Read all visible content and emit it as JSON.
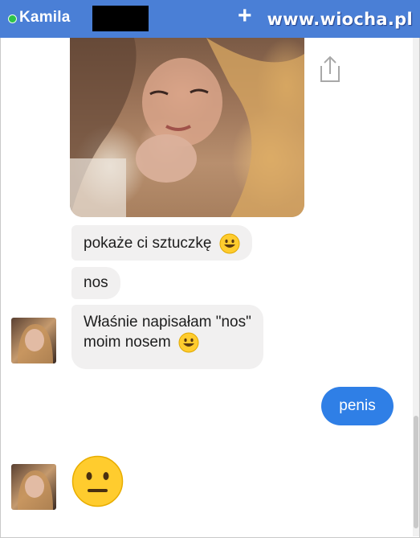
{
  "header": {
    "contact_name": "Kamila",
    "online": true,
    "watermark": "www.wiocha.pl",
    "add_icon": "plus-icon"
  },
  "messages": [
    {
      "from": "contact",
      "type": "image"
    },
    {
      "from": "contact",
      "type": "text",
      "text": "pokaże ci sztuczkę",
      "emoji": "grinning-face"
    },
    {
      "from": "contact",
      "type": "text",
      "text": "nos"
    },
    {
      "from": "contact",
      "type": "text",
      "line1": "Właśnie napisałam \"nos\"",
      "line2": "moim nosem",
      "emoji": "grinning-face"
    },
    {
      "from": "me",
      "type": "text",
      "text": "penis"
    },
    {
      "from": "contact",
      "type": "emoji",
      "emoji": "neutral-face"
    }
  ],
  "colors": {
    "header_bg": "#4a7fd6",
    "incoming_bubble": "#f1f0f0",
    "outgoing_bubble": "#2f7fe6",
    "online_dot": "#2dc24a"
  }
}
